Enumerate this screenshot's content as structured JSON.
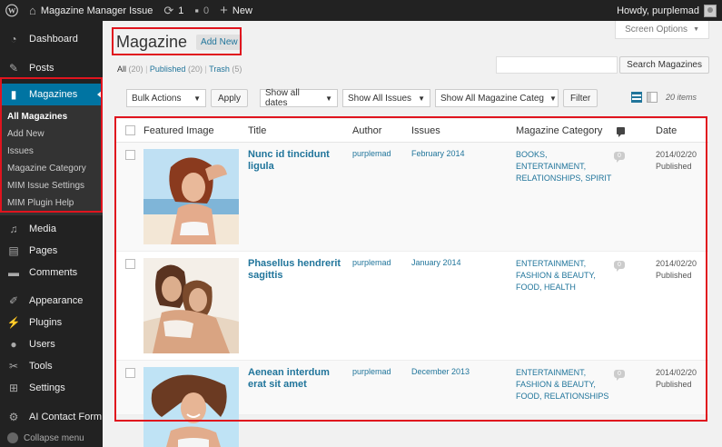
{
  "adminbar": {
    "site_name": "Magazine Manager Issue",
    "updates_count": "1",
    "comments_count": "0",
    "new_label": "New",
    "howdy": "Howdy, purplemad"
  },
  "sidebar": {
    "items_top": [
      {
        "label": "Dashboard",
        "icon": "dashboard-icon"
      },
      {
        "label": "Posts",
        "icon": "pin-icon"
      }
    ],
    "current": {
      "label": "Magazines",
      "icon": "book-icon"
    },
    "submenu": [
      {
        "label": "All Magazines",
        "active": true
      },
      {
        "label": "Add New"
      },
      {
        "label": "Issues"
      },
      {
        "label": "Magazine Category"
      },
      {
        "label": "MIM Issue Settings"
      },
      {
        "label": "MIM Plugin Help"
      }
    ],
    "items_mid": [
      {
        "label": "Media",
        "icon": "media-icon"
      },
      {
        "label": "Pages",
        "icon": "pages-icon"
      },
      {
        "label": "Comments",
        "icon": "comments-icon"
      }
    ],
    "items_bottom": [
      {
        "label": "Appearance",
        "icon": "appearance-icon"
      },
      {
        "label": "Plugins",
        "icon": "plugins-icon"
      },
      {
        "label": "Users",
        "icon": "users-icon"
      },
      {
        "label": "Tools",
        "icon": "tools-icon"
      },
      {
        "label": "Settings",
        "icon": "settings-icon"
      }
    ],
    "items_extra": [
      {
        "label": "AI Contact Form",
        "icon": "gear-icon"
      }
    ],
    "collapse_label": "Collapse menu"
  },
  "header": {
    "screen_options": "Screen Options",
    "title": "Magazine",
    "add_new": "Add New"
  },
  "views": {
    "all": "All",
    "all_count": "(20)",
    "published": "Published",
    "published_count": "(20)",
    "trash": "Trash",
    "trash_count": "(5)"
  },
  "search": {
    "placeholder": "",
    "button": "Search Magazines"
  },
  "tablenav": {
    "bulk_actions": "Bulk Actions",
    "apply": "Apply",
    "dates": "Show all dates",
    "issues": "Show All Issues",
    "categories": "Show All Magazine Categ",
    "filter": "Filter",
    "item_count": "20 items"
  },
  "table": {
    "columns": {
      "image": "Featured Image",
      "title": "Title",
      "author": "Author",
      "issues": "Issues",
      "category": "Magazine Category",
      "date": "Date"
    },
    "rows": [
      {
        "title_line1": "Nunc id tincidunt",
        "title_line2": "ligula",
        "author": "purplemad",
        "issue": "February 2014",
        "cat_line1": "BOOKS,",
        "cat_line2": "ENTERTAINMENT,",
        "cat_line3": "RELATIONSHIPS, SPIRIT",
        "comments": "0",
        "date": "2014/02/20",
        "status": "Published"
      },
      {
        "title_line1": "Phasellus hendrerit",
        "title_line2": "sagittis",
        "author": "purplemad",
        "issue": "January 2014",
        "cat_line1": "ENTERTAINMENT,",
        "cat_line2": "FASHION & BEAUTY,",
        "cat_line3": "FOOD, HEALTH",
        "comments": "0",
        "date": "2014/02/20",
        "status": "Published"
      },
      {
        "title_line1": "Aenean interdum",
        "title_line2": "erat sit amet",
        "author": "purplemad",
        "issue": "December 2013",
        "cat_line1": "ENTERTAINMENT,",
        "cat_line2": "FASHION & BEAUTY,",
        "cat_line3": "FOOD, RELATIONSHIPS",
        "comments": "0",
        "date": "2014/02/20",
        "status": "Published"
      }
    ]
  },
  "colors": {
    "admin_dark": "#222222",
    "accent": "#0074a2",
    "link": "#21759b",
    "highlight": "#e0141e"
  }
}
